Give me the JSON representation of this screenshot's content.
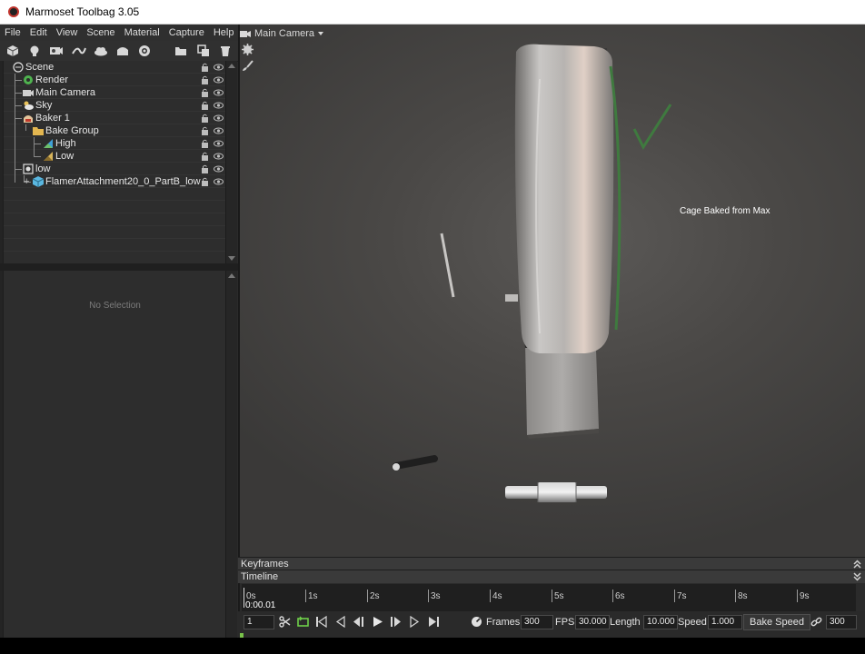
{
  "window": {
    "title": "Marmoset Toolbag 3.05"
  },
  "menu": [
    "File",
    "Edit",
    "View",
    "Scene",
    "Material",
    "Capture",
    "Help"
  ],
  "toolbar_icons": [
    "mesh-icon",
    "light-icon",
    "camera-add-icon",
    "curve-icon",
    "sky-icon",
    "baker-icon",
    "turntable-icon",
    "folder-icon",
    "duplicate-icon",
    "trash-icon"
  ],
  "scene_tree": [
    {
      "label": "Scene",
      "icon": "scene-icon"
    },
    {
      "label": "Render",
      "icon": "render-icon"
    },
    {
      "label": "Main Camera",
      "icon": "camera-icon"
    },
    {
      "label": "Sky",
      "icon": "sky-icon"
    },
    {
      "label": "Baker 1",
      "icon": "baker-icon"
    },
    {
      "label": "Bake Group",
      "icon": "folder-icon"
    },
    {
      "label": "High",
      "icon": "high-mesh-icon"
    },
    {
      "label": "Low",
      "icon": "low-mesh-icon"
    },
    {
      "label": "low",
      "icon": "object-icon"
    },
    {
      "label": "FlamerAttachment20_0_PartB_low",
      "icon": "mesh-icon"
    }
  ],
  "properties": {
    "empty_text": "No Selection"
  },
  "viewport": {
    "camera_label": "Main Camera",
    "annotation": "Cage Baked from Max"
  },
  "keyframes_label": "Keyframes",
  "timeline": {
    "label": "Timeline",
    "ticks": [
      "0s",
      "1s",
      "2s",
      "3s",
      "4s",
      "5s",
      "6s",
      "7s",
      "8s",
      "9s"
    ],
    "current_time": "0:00.01"
  },
  "controls": {
    "frame": "1",
    "frames_label": "Frames",
    "frames": "300",
    "fps_label": "FPS",
    "fps": "30.000",
    "length_label": "Length",
    "length": "10.000",
    "speed_label": "Speed",
    "speed": "1.000",
    "bake_speed_label": "Bake Speed",
    "bake_frames": "300"
  }
}
